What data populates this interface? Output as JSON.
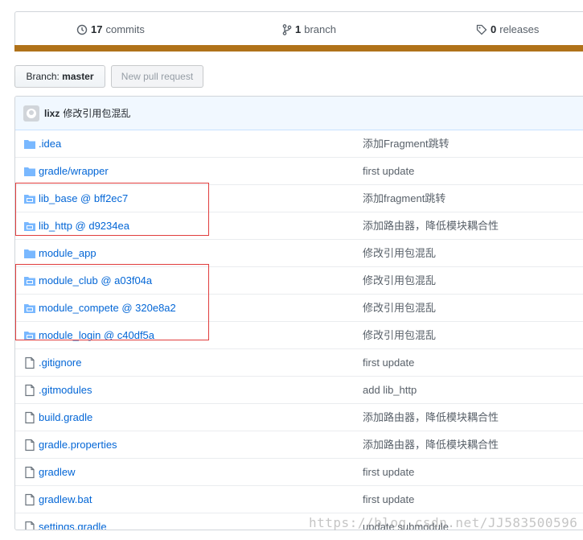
{
  "summary": {
    "commits_count": "17",
    "commits_label": "commits",
    "branch_count": "1",
    "branch_label": "branch",
    "releases_count": "0",
    "releases_label": "releases",
    "language_color": "#b07219"
  },
  "toolbar": {
    "branch_prefix": "Branch:",
    "branch_name": "master",
    "new_pr_label": "New pull request"
  },
  "latest_commit": {
    "author": "lixz",
    "message": "修改引用包混乱"
  },
  "files": [
    {
      "name": ".idea",
      "type": "folder",
      "message": "添加Fragment跳转"
    },
    {
      "name": "gradle/wrapper",
      "type": "folder",
      "message": "first update"
    },
    {
      "name": "lib_base @ bff2ec7",
      "type": "submodule",
      "message": "添加fragment跳转"
    },
    {
      "name": "lib_http @ d9234ea",
      "type": "submodule",
      "message": "添加路由器，降低模块耦合性"
    },
    {
      "name": "module_app",
      "type": "folder",
      "message": "修改引用包混乱"
    },
    {
      "name": "module_club @ a03f04a",
      "type": "submodule",
      "message": "修改引用包混乱"
    },
    {
      "name": "module_compete @ 320e8a2",
      "type": "submodule",
      "message": "修改引用包混乱"
    },
    {
      "name": "module_login @ c40df5a",
      "type": "submodule",
      "message": "修改引用包混乱"
    },
    {
      "name": ".gitignore",
      "type": "file",
      "message": "first update"
    },
    {
      "name": ".gitmodules",
      "type": "file",
      "message": "add lib_http"
    },
    {
      "name": "build.gradle",
      "type": "file",
      "message": "添加路由器，降低模块耦合性"
    },
    {
      "name": "gradle.properties",
      "type": "file",
      "message": "添加路由器，降低模块耦合性"
    },
    {
      "name": "gradlew",
      "type": "file",
      "message": "first update"
    },
    {
      "name": "gradlew.bat",
      "type": "file",
      "message": "first update"
    },
    {
      "name": "settings.gradle",
      "type": "file",
      "message": "update submodule"
    }
  ],
  "watermark": "https://blog.csdn.net/JJ583500596"
}
